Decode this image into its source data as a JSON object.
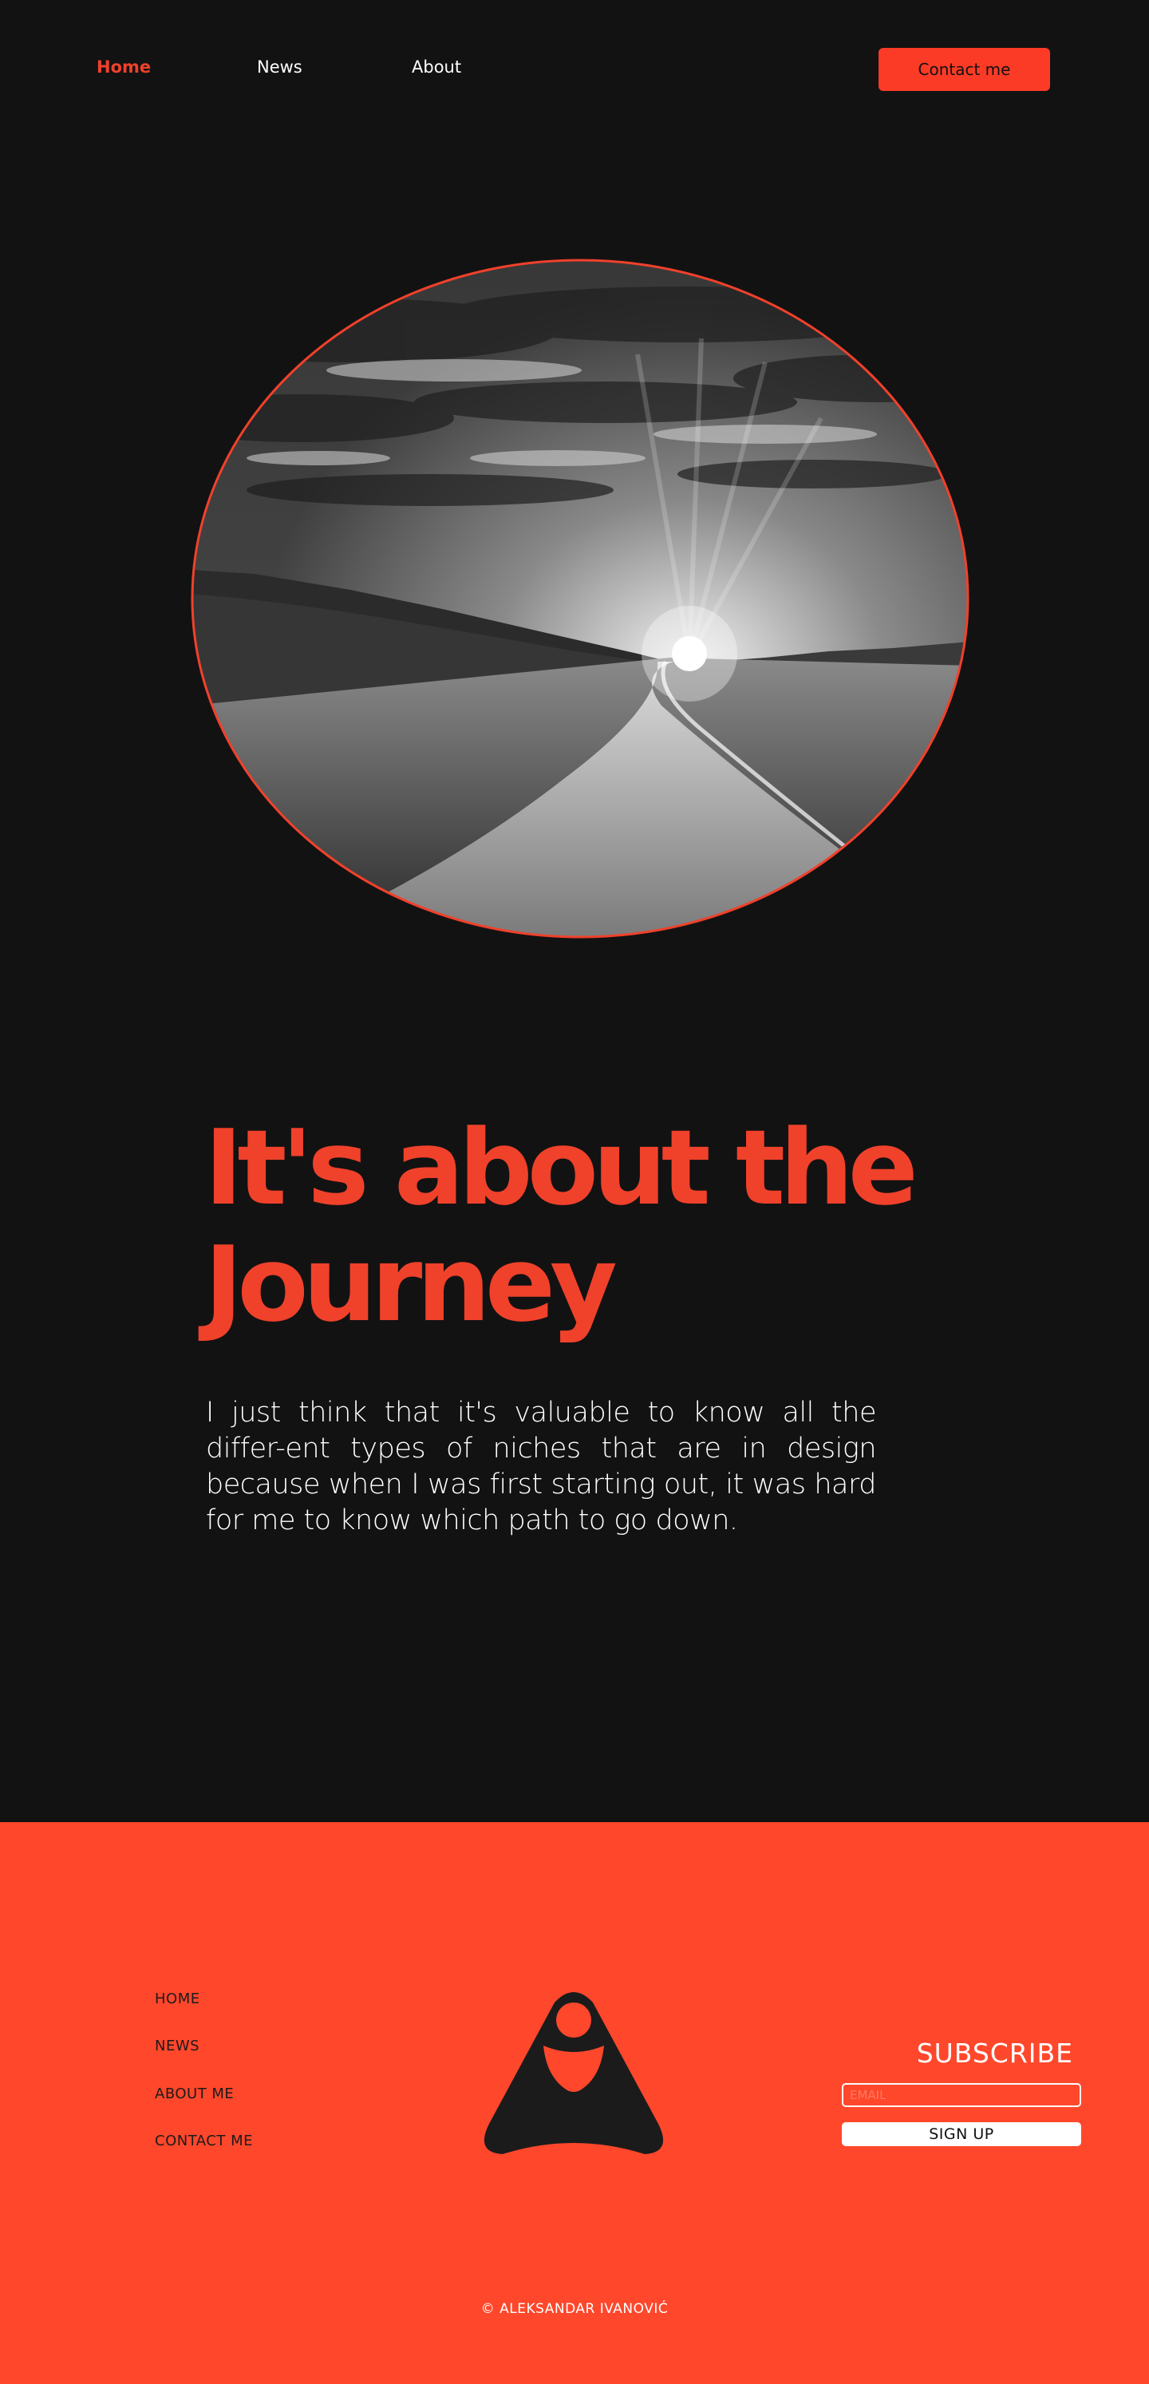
{
  "nav": {
    "items": [
      {
        "label": "Home",
        "active": true
      },
      {
        "label": "News",
        "active": false
      },
      {
        "label": "About",
        "active": false
      }
    ],
    "contact_label": "Contact me"
  },
  "hero": {
    "image": "circular black-and-white photo of a gravel road leading to the sun on the horizon",
    "border_color": "#f0412b"
  },
  "headline": {
    "line1": "It's about the",
    "line2": "Journey"
  },
  "intro": {
    "text": "I just think that it's valuable to know all the differ-ent types of niches that are in design because when I was first starting out, it was hard for me to know which path to go down."
  },
  "footer": {
    "links": [
      "HOME",
      "NEWS",
      "ABOUT ME",
      "CONTACT ME"
    ],
    "logo": "triangle-person-logo",
    "subscribe_title": "SUBSCRIBE",
    "email_placeholder": "EMAIL",
    "signup_label": "SIGN UP",
    "copyright": "© ALEKSANDAR IVANOVIĆ"
  },
  "colors": {
    "background": "#121212",
    "accent": "#f0412b",
    "button": "#fb3b26",
    "footer": "#ff472b",
    "text": "#ffffff"
  }
}
